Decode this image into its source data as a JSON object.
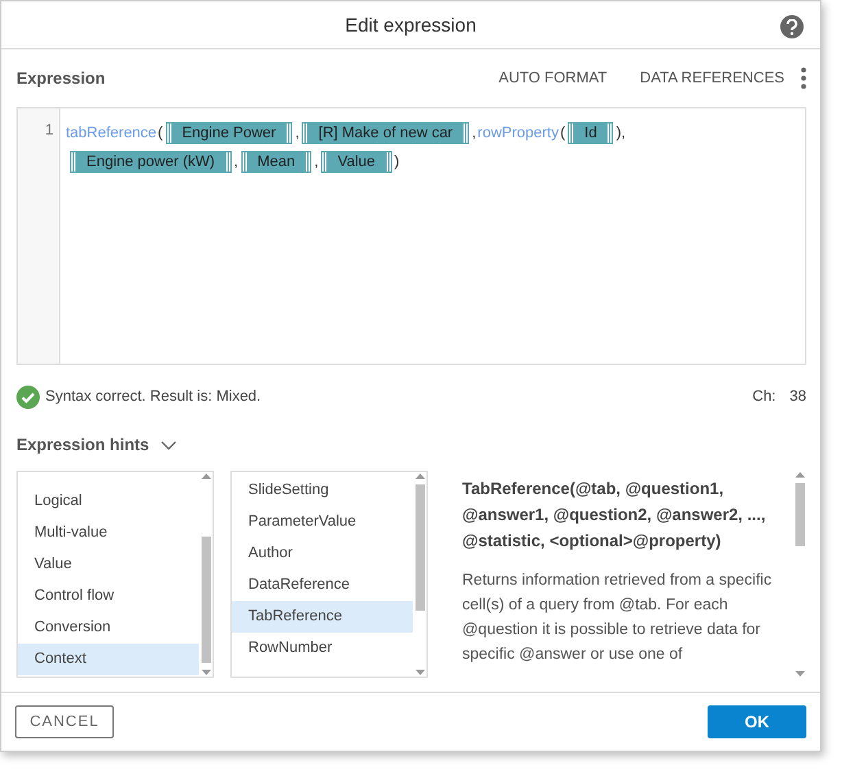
{
  "window": {
    "title": "Edit expression"
  },
  "expression": {
    "label": "Expression",
    "actions": [
      "AUTO FORMAT",
      "DATA REFERENCES"
    ],
    "lines": [
      {
        "number": "1",
        "tokens": [
          {
            "kind": "function",
            "text": "tabReference"
          },
          {
            "kind": "punct",
            "text": "("
          },
          {
            "kind": "chip",
            "text": "Engine Power"
          },
          {
            "kind": "punct",
            "text": ","
          },
          {
            "kind": "chip",
            "text": "[R] Make of new car"
          },
          {
            "kind": "punct",
            "text": ","
          },
          {
            "kind": "function",
            "text": "rowProperty"
          },
          {
            "kind": "punct",
            "text": "("
          },
          {
            "kind": "chip",
            "text": "Id"
          },
          {
            "kind": "punct",
            "text": "),"
          }
        ]
      },
      {
        "tokens": [
          {
            "kind": "chip",
            "text": "Engine power (kW)"
          },
          {
            "kind": "punct",
            "text": ","
          },
          {
            "kind": "chip",
            "text": "Mean"
          },
          {
            "kind": "punct",
            "text": ","
          },
          {
            "kind": "chip",
            "text": "Value"
          },
          {
            "kind": "punct",
            "text": ")"
          }
        ]
      }
    ]
  },
  "status": {
    "valid": true,
    "message": "Syntax correct. Result is: Mixed.",
    "count_label": "Ch:",
    "count": "38"
  },
  "hints": {
    "label": "Expression hints",
    "expanded": true,
    "categories": [
      {
        "label": "Logical",
        "selected": false
      },
      {
        "label": "Multi-value",
        "selected": false
      },
      {
        "label": "Value",
        "selected": false
      },
      {
        "label": "Control flow",
        "selected": false
      },
      {
        "label": "Conversion",
        "selected": false
      },
      {
        "label": "Context",
        "selected": true
      }
    ],
    "functions": [
      {
        "label": "SlideSetting",
        "selected": false
      },
      {
        "label": "ParameterValue",
        "selected": false
      },
      {
        "label": "Author",
        "selected": false
      },
      {
        "label": "DataReference",
        "selected": false
      },
      {
        "label": "TabReference",
        "selected": true
      },
      {
        "label": "RowNumber",
        "selected": false
      }
    ],
    "signature": "TabReference(@tab, @question1, @answer1, @question2, @answer2, ..., @statistic, <optional>@property)",
    "description": "Returns information retrieved from a specific cell(s) of a query from @tab. For each @question it is possible to retrieve data for specific @answer or use one of"
  },
  "buttons": {
    "cancel": "CANCEL",
    "ok": "OK"
  }
}
